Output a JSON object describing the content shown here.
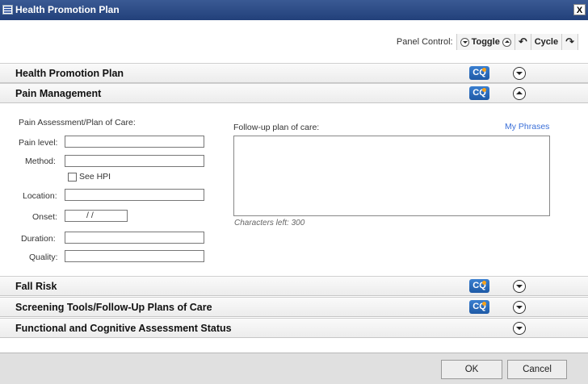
{
  "window": {
    "title": "Health Promotion Plan",
    "close_glyph": "X"
  },
  "panel_control": {
    "label": "Panel Control:",
    "toggle_label": "Toggle",
    "cycle_label": "Cycle"
  },
  "sections": {
    "health_promotion": {
      "title": "Health Promotion Plan",
      "icon_text": "CQ",
      "state": "collapsed"
    },
    "pain_management": {
      "title": "Pain Management",
      "icon_text": "CQ",
      "state": "expanded"
    },
    "fall_risk": {
      "title": "Fall Risk",
      "icon_text": "CQ",
      "state": "collapsed"
    },
    "screening": {
      "title": "Screening Tools/Follow-Up Plans of Care",
      "icon_text": "CQ",
      "state": "collapsed"
    },
    "functional": {
      "title": "Functional and Cognitive Assessment Status",
      "state": "collapsed"
    }
  },
  "pain_form": {
    "heading": "Pain Assessment/Plan of Care:",
    "pain_level_label": "Pain level:",
    "pain_level_value": "",
    "method_label": "Method:",
    "method_value": "",
    "see_hpi_label": "See HPI",
    "see_hpi_checked": false,
    "location_label": "Location:",
    "location_value": "",
    "onset_label": "Onset:",
    "onset_value": "/ /",
    "duration_label": "Duration:",
    "duration_value": "",
    "quality_label": "Quality:",
    "quality_value": ""
  },
  "followup": {
    "label": "Follow-up plan of care:",
    "phrases_link": "My Phrases",
    "value": "",
    "chars_left": "Characters left: 300"
  },
  "footer": {
    "ok_label": "OK",
    "cancel_label": "Cancel"
  }
}
